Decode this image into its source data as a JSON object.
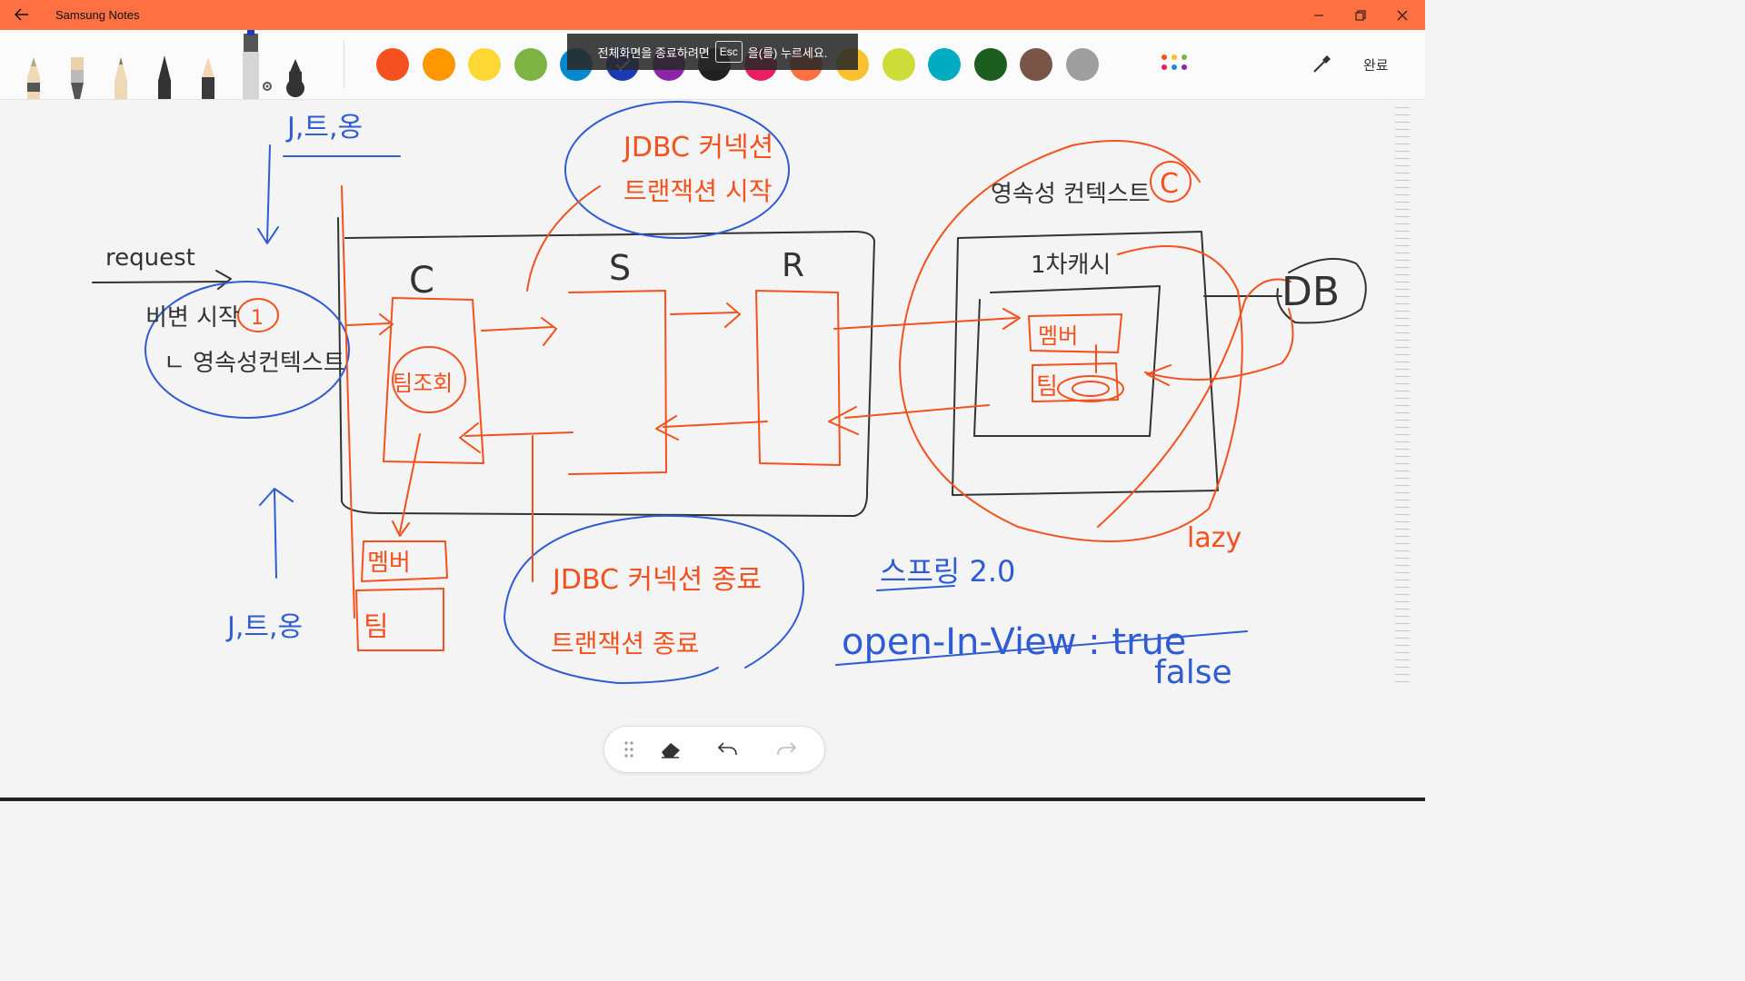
{
  "window": {
    "title": "Samsung Notes",
    "back_icon": "back-arrow-icon",
    "controls": [
      "minimize-icon",
      "restore-icon",
      "close-icon"
    ]
  },
  "toolbar": {
    "pens": [
      "brush-pen",
      "flat-brush-pen",
      "pencil",
      "fountain-pen",
      "calligraphy-pen",
      "marker-selected",
      "ink-pen"
    ],
    "colors": [
      "#f4511e",
      "#ff9800",
      "#fdd835",
      "#7cb342",
      "#0288d1",
      "#1a3bb3",
      "#8e24aa",
      "#212121",
      "#e91e63",
      "#ff7043",
      "#fbc02d",
      "#cddc39",
      "#00acc1",
      "#1b5e20",
      "#795548",
      "#9e9e9e"
    ],
    "selected_color": "#1a3bb3",
    "done_label": "완료"
  },
  "fullscreen_notice": {
    "before": "전체화면을 종료하려면",
    "key": "Esc",
    "after": "을(를) 누르세요."
  },
  "sketch": {
    "jsession_top": "J,트,옹",
    "jsession_bottom": "J,트,옹",
    "request": "request",
    "request_start": "비변 시작",
    "request_circle_num": "1",
    "persist_context_note": "ㄴ 영속성컨텍스트",
    "jdbc_top_line1": "JDBC 커넥션",
    "jdbc_top_line2": "트랜잭션 시작",
    "jdbc_bottom_line1": "JDBC 커넥션 종료",
    "jdbc_bottom_line2": "트랜잭션 종료",
    "layer_c": "C",
    "layer_s": "S",
    "layer_r": "R",
    "team_lazy": "팀조회",
    "member": "멤버",
    "team": "팀",
    "context_title": "영속성 컨텍스트",
    "context_num": "C",
    "cache_title": "1차캐시",
    "cache_member": "멤버",
    "cache_team": "팀",
    "db": "DB",
    "lazy": "lazy",
    "spring_version": "스프링 2.0",
    "osiv": "open-In-View : true",
    "osiv_false": "false"
  },
  "floating_toolbar": [
    "drag-handle-icon",
    "eraser-icon",
    "undo-icon",
    "redo-icon"
  ]
}
